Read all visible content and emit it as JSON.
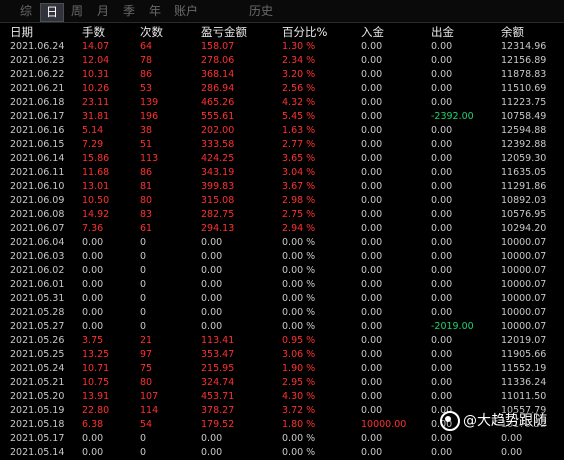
{
  "tabs": [
    {
      "label": "综",
      "active": false
    },
    {
      "label": "日",
      "active": true
    },
    {
      "label": "周",
      "active": false
    },
    {
      "label": "月",
      "active": false
    },
    {
      "label": "季",
      "active": false
    },
    {
      "label": "年",
      "active": false
    },
    {
      "label": "账户",
      "active": false
    },
    {
      "label": "历史",
      "active": false
    }
  ],
  "columns": {
    "date": "日期",
    "hands": "手数",
    "times": "次数",
    "pnl": "盈亏金额",
    "pct": "百分比%",
    "in": "入金",
    "out": "出金",
    "balance": "余额"
  },
  "rows": [
    {
      "date": "2021.06.24",
      "hands": "14.07",
      "times": "64",
      "pnl": "158.07",
      "pct": "1.30 %",
      "in": "0.00",
      "out": "0.00",
      "balance": "12314.96",
      "positive": true
    },
    {
      "date": "2021.06.23",
      "hands": "12.04",
      "times": "78",
      "pnl": "278.06",
      "pct": "2.34 %",
      "in": "0.00",
      "out": "0.00",
      "balance": "12156.89",
      "positive": true
    },
    {
      "date": "2021.06.22",
      "hands": "10.31",
      "times": "86",
      "pnl": "368.14",
      "pct": "3.20 %",
      "in": "0.00",
      "out": "0.00",
      "balance": "11878.83",
      "positive": true
    },
    {
      "date": "2021.06.21",
      "hands": "10.26",
      "times": "53",
      "pnl": "286.94",
      "pct": "2.56 %",
      "in": "0.00",
      "out": "0.00",
      "balance": "11510.69",
      "positive": true
    },
    {
      "date": "2021.06.18",
      "hands": "23.11",
      "times": "139",
      "pnl": "465.26",
      "pct": "4.32 %",
      "in": "0.00",
      "out": "0.00",
      "balance": "11223.75",
      "positive": true
    },
    {
      "date": "2021.06.17",
      "hands": "31.81",
      "times": "196",
      "pnl": "555.61",
      "pct": "5.45 %",
      "in": "0.00",
      "out": "-2392.00",
      "balance": "10758.49",
      "positive": true,
      "out_green": true
    },
    {
      "date": "2021.06.16",
      "hands": "5.14",
      "times": "38",
      "pnl": "202.00",
      "pct": "1.63 %",
      "in": "0.00",
      "out": "0.00",
      "balance": "12594.88",
      "positive": true
    },
    {
      "date": "2021.06.15",
      "hands": "7.29",
      "times": "51",
      "pnl": "333.58",
      "pct": "2.77 %",
      "in": "0.00",
      "out": "0.00",
      "balance": "12392.88",
      "positive": true
    },
    {
      "date": "2021.06.14",
      "hands": "15.86",
      "times": "113",
      "pnl": "424.25",
      "pct": "3.65 %",
      "in": "0.00",
      "out": "0.00",
      "balance": "12059.30",
      "positive": true
    },
    {
      "date": "2021.06.11",
      "hands": "11.68",
      "times": "86",
      "pnl": "343.19",
      "pct": "3.04 %",
      "in": "0.00",
      "out": "0.00",
      "balance": "11635.05",
      "positive": true
    },
    {
      "date": "2021.06.10",
      "hands": "13.01",
      "times": "81",
      "pnl": "399.83",
      "pct": "3.67 %",
      "in": "0.00",
      "out": "0.00",
      "balance": "11291.86",
      "positive": true
    },
    {
      "date": "2021.06.09",
      "hands": "10.50",
      "times": "80",
      "pnl": "315.08",
      "pct": "2.98 %",
      "in": "0.00",
      "out": "0.00",
      "balance": "10892.03",
      "positive": true
    },
    {
      "date": "2021.06.08",
      "hands": "14.92",
      "times": "83",
      "pnl": "282.75",
      "pct": "2.75 %",
      "in": "0.00",
      "out": "0.00",
      "balance": "10576.95",
      "positive": true
    },
    {
      "date": "2021.06.07",
      "hands": "7.36",
      "times": "61",
      "pnl": "294.13",
      "pct": "2.94 %",
      "in": "0.00",
      "out": "0.00",
      "balance": "10294.20",
      "positive": true
    },
    {
      "date": "2021.06.04",
      "hands": "0.00",
      "times": "0",
      "pnl": "0.00",
      "pct": "0.00 %",
      "in": "0.00",
      "out": "0.00",
      "balance": "10000.07",
      "positive": false
    },
    {
      "date": "2021.06.03",
      "hands": "0.00",
      "times": "0",
      "pnl": "0.00",
      "pct": "0.00 %",
      "in": "0.00",
      "out": "0.00",
      "balance": "10000.07",
      "positive": false
    },
    {
      "date": "2021.06.02",
      "hands": "0.00",
      "times": "0",
      "pnl": "0.00",
      "pct": "0.00 %",
      "in": "0.00",
      "out": "0.00",
      "balance": "10000.07",
      "positive": false
    },
    {
      "date": "2021.06.01",
      "hands": "0.00",
      "times": "0",
      "pnl": "0.00",
      "pct": "0.00 %",
      "in": "0.00",
      "out": "0.00",
      "balance": "10000.07",
      "positive": false
    },
    {
      "date": "2021.05.31",
      "hands": "0.00",
      "times": "0",
      "pnl": "0.00",
      "pct": "0.00 %",
      "in": "0.00",
      "out": "0.00",
      "balance": "10000.07",
      "positive": false
    },
    {
      "date": "2021.05.28",
      "hands": "0.00",
      "times": "0",
      "pnl": "0.00",
      "pct": "0.00 %",
      "in": "0.00",
      "out": "0.00",
      "balance": "10000.07",
      "positive": false
    },
    {
      "date": "2021.05.27",
      "hands": "0.00",
      "times": "0",
      "pnl": "0.00",
      "pct": "0.00 %",
      "in": "0.00",
      "out": "-2019.00",
      "balance": "10000.07",
      "positive": false,
      "out_green": true
    },
    {
      "date": "2021.05.26",
      "hands": "3.75",
      "times": "21",
      "pnl": "113.41",
      "pct": "0.95 %",
      "in": "0.00",
      "out": "0.00",
      "balance": "12019.07",
      "positive": true
    },
    {
      "date": "2021.05.25",
      "hands": "13.25",
      "times": "97",
      "pnl": "353.47",
      "pct": "3.06 %",
      "in": "0.00",
      "out": "0.00",
      "balance": "11905.66",
      "positive": true
    },
    {
      "date": "2021.05.24",
      "hands": "10.71",
      "times": "75",
      "pnl": "215.95",
      "pct": "1.90 %",
      "in": "0.00",
      "out": "0.00",
      "balance": "11552.19",
      "positive": true
    },
    {
      "date": "2021.05.21",
      "hands": "10.75",
      "times": "80",
      "pnl": "324.74",
      "pct": "2.95 %",
      "in": "0.00",
      "out": "0.00",
      "balance": "11336.24",
      "positive": true
    },
    {
      "date": "2021.05.20",
      "hands": "13.91",
      "times": "107",
      "pnl": "453.71",
      "pct": "4.30 %",
      "in": "0.00",
      "out": "0.00",
      "balance": "11011.50",
      "positive": true
    },
    {
      "date": "2021.05.19",
      "hands": "22.80",
      "times": "114",
      "pnl": "378.27",
      "pct": "3.72 %",
      "in": "0.00",
      "out": "0.00",
      "balance": "10557.79",
      "positive": true
    },
    {
      "date": "2021.05.18",
      "hands": "6.38",
      "times": "54",
      "pnl": "179.52",
      "pct": "1.80 %",
      "in": "10000.00",
      "out": "0.00",
      "balance": "10179.52",
      "positive": true,
      "in_red": true
    },
    {
      "date": "2021.05.17",
      "hands": "0.00",
      "times": "0",
      "pnl": "0.00",
      "pct": "0.00 %",
      "in": "0.00",
      "out": "0.00",
      "balance": "0.00",
      "positive": false
    },
    {
      "date": "2021.05.14",
      "hands": "0.00",
      "times": "0",
      "pnl": "0.00",
      "pct": "0.00 %",
      "in": "0.00",
      "out": "0.00",
      "balance": "0.00",
      "positive": false
    }
  ],
  "watermark": {
    "text": "@大趋势跟随",
    "icon": "weibo-camera-icon"
  },
  "colors": {
    "positive": "#ff3030",
    "neutral": "#c8c8c8",
    "withdraw": "#20d070",
    "active_tab": "#30343a"
  }
}
